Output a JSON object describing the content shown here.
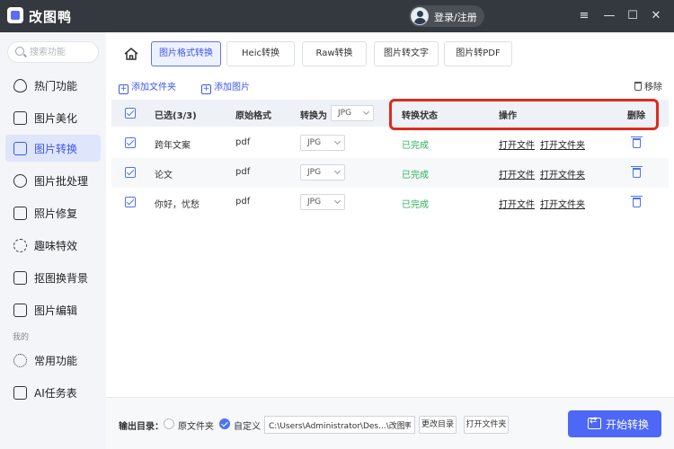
{
  "app": {
    "title": "改图鸭",
    "login_label": "登录/注册"
  },
  "window_controls": {
    "menu": "≡",
    "minimize": "—",
    "maximize": "☐",
    "close": "✕"
  },
  "search": {
    "placeholder": "搜索功能"
  },
  "sidebar": {
    "items": [
      {
        "label": "热门功能",
        "icon": "fire-icon"
      },
      {
        "label": "图片美化",
        "icon": "image-beautify-icon"
      },
      {
        "label": "图片转换",
        "icon": "image-convert-icon",
        "active": true
      },
      {
        "label": "图片批处理",
        "icon": "batch-icon"
      },
      {
        "label": "照片修复",
        "icon": "photo-repair-icon"
      },
      {
        "label": "趣味特效",
        "icon": "effects-icon"
      },
      {
        "label": "抠图换背景",
        "icon": "cutout-icon"
      },
      {
        "label": "图片编辑",
        "icon": "image-edit-icon"
      }
    ],
    "section_label": "我的",
    "my_items": [
      {
        "label": "常用功能",
        "icon": "grid-icon"
      },
      {
        "label": "AI任务表",
        "icon": "ai-task-icon"
      }
    ]
  },
  "tabs": [
    {
      "label": "图片格式转换",
      "active": true
    },
    {
      "label": "Heic转换"
    },
    {
      "label": "Raw转换"
    },
    {
      "label": "图片转文字"
    },
    {
      "label": "图片转PDF"
    }
  ],
  "toolbar": {
    "add_folder": "添加文件夹",
    "add_image": "添加图片",
    "remove": "移除"
  },
  "table": {
    "headers": {
      "selected": "已选(3/3)",
      "original_format": "原始格式",
      "convert_to": "转换为",
      "convert_to_value": "JPG",
      "status": "转换状态",
      "actions": "操作",
      "delete": "删除"
    },
    "rows": [
      {
        "name": "跨年文案",
        "format": "pdf",
        "target": "JPG",
        "status": "已完成",
        "open_file": "打开文件",
        "open_folder": "打开文件夹"
      },
      {
        "name": "论文",
        "format": "pdf",
        "target": "JPG",
        "status": "已完成",
        "open_file": "打开文件",
        "open_folder": "打开文件夹"
      },
      {
        "name": "你好，忧愁",
        "format": "pdf",
        "target": "JPG",
        "status": "已完成",
        "open_file": "打开文件",
        "open_folder": "打开文件夹"
      }
    ]
  },
  "footer": {
    "output_label": "输出目录：",
    "option_original": "原文件夹",
    "option_custom": "自定义",
    "path_value": "C:\\Users\\Administrator\\Des...\\改图鸭",
    "change_dir": "更改目录",
    "open_folder": "打开文件夹",
    "start": "开始转换"
  },
  "colors": {
    "accent": "#4d67f6",
    "status_done": "#27b35a",
    "highlight": "#e02a1f"
  }
}
